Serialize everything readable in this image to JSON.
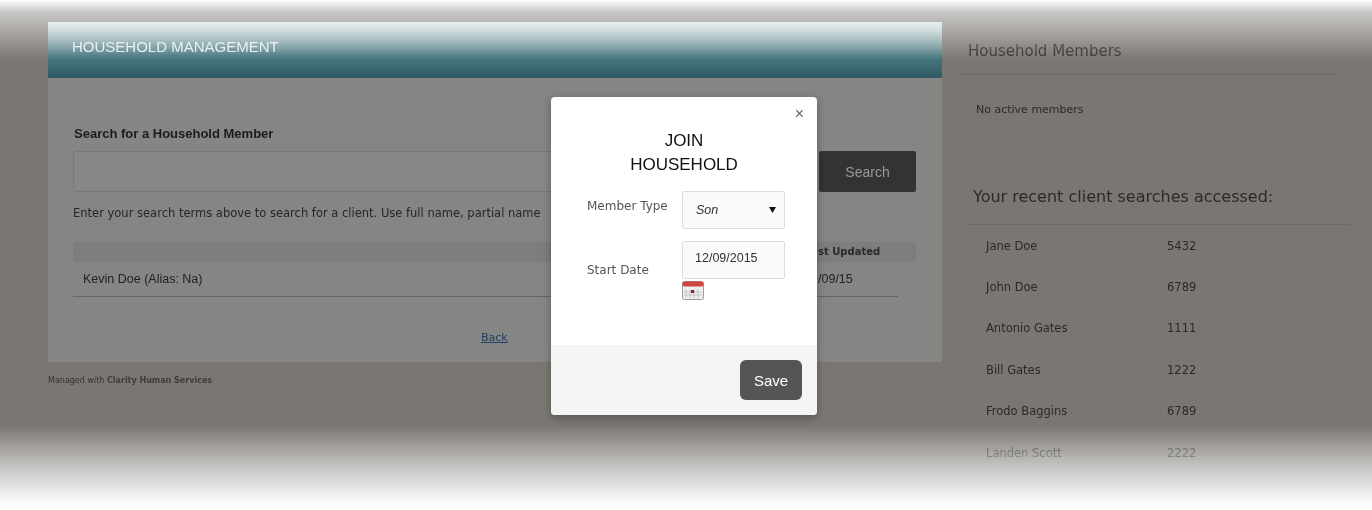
{
  "page_header": {
    "title": "HOUSEHOLD MANAGEMENT"
  },
  "search": {
    "heading": "Search for a Household Member",
    "button": "Search",
    "help": "Enter your search terms above to search for a client. Use full name, partial name"
  },
  "results": {
    "columns": [
      "st Updated"
    ],
    "rows": [
      {
        "name": "Kevin Doe (Alias: Na)",
        "updated": "/09/15"
      }
    ]
  },
  "back_link": "Back",
  "footer": "Managed with **Clarity Human Services**",
  "household_members": {
    "title": "Household Members",
    "empty_text": "No active members"
  },
  "recent_searches": {
    "title": "Your recent client searches accessed:",
    "rows": [
      {
        "name": "Jane Doe",
        "id": "5432"
      },
      {
        "name": "John Doe",
        "id": "6789"
      },
      {
        "name": "Antonio Gates",
        "id": "1111"
      },
      {
        "name": "Bill Gates",
        "id": "1222"
      },
      {
        "name": "Frodo Baggins",
        "id": "6789"
      },
      {
        "name": "Landen Scott",
        "id": "2222"
      }
    ]
  },
  "modal": {
    "title": "JOIN HOUSEHOLD",
    "close": "×",
    "fields": [
      {
        "kind": "select",
        "label": "Member Type",
        "value": "Son"
      },
      {
        "kind": "date",
        "label": "Start Date",
        "value": "12/09/2015"
      }
    ],
    "button": "Save"
  }
}
